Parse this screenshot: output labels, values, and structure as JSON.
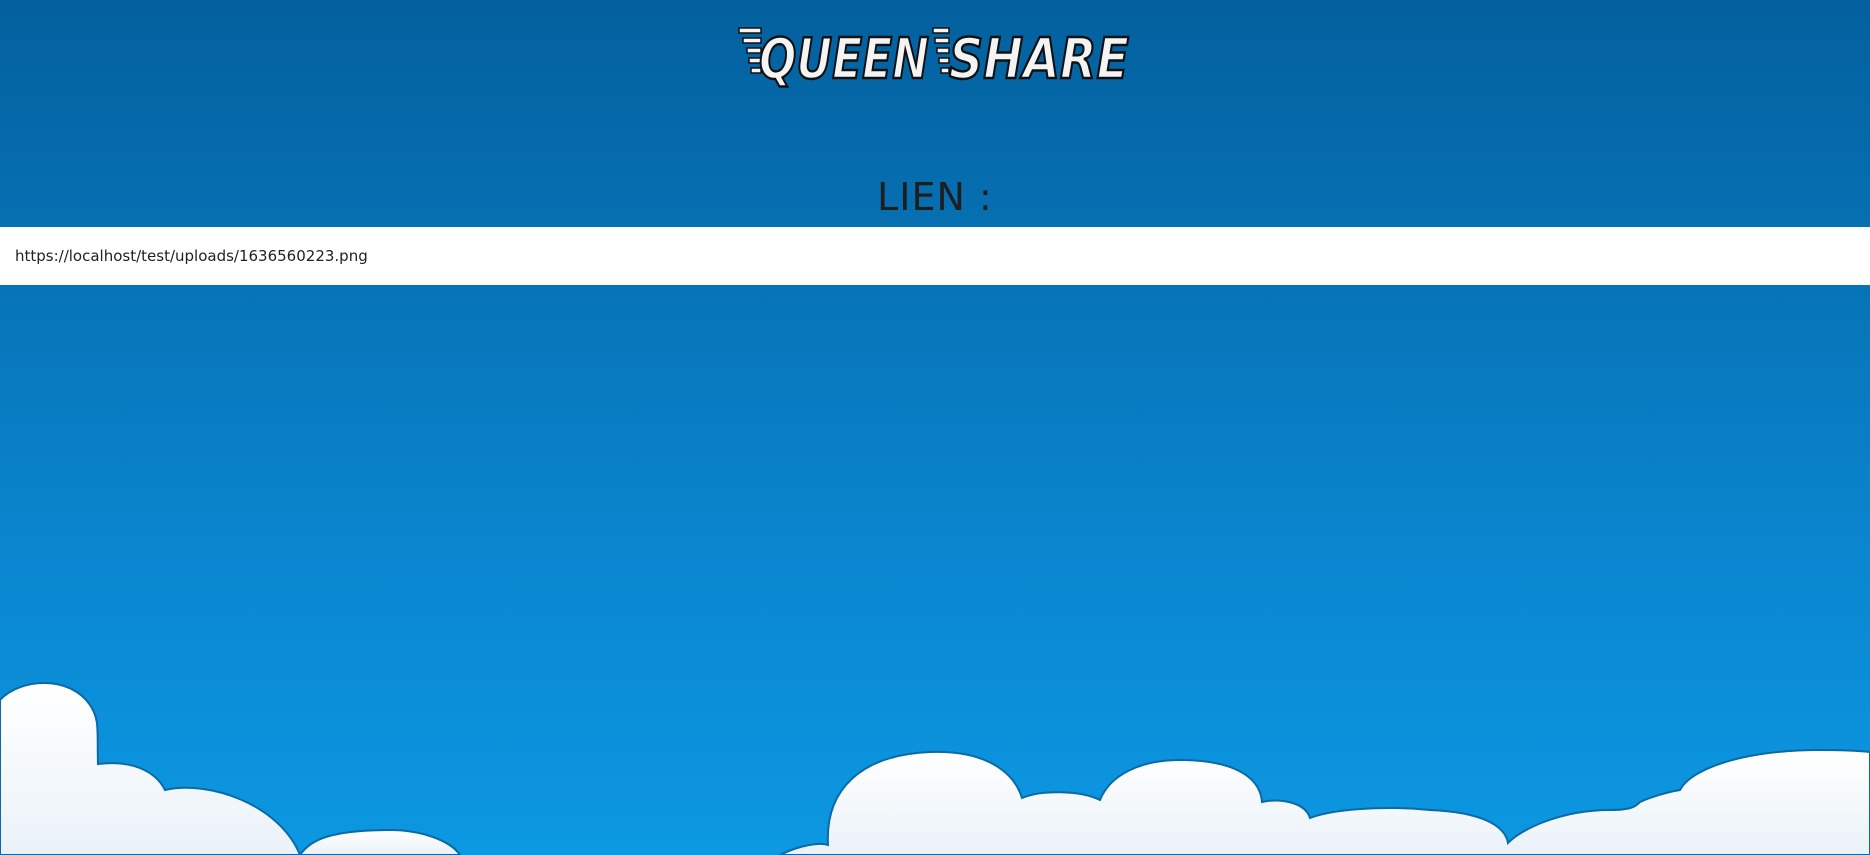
{
  "header": {
    "logo_text_left": "QUEEN",
    "logo_text_right": "SHARE"
  },
  "main": {
    "link_label": "LIEN :",
    "link_value": "https://localhost/test/uploads/1636560223.png"
  },
  "colors": {
    "sky_top": "#04609e",
    "sky_bottom": "#0c98e2",
    "cloud_fill": "#ffffff",
    "cloud_stroke": "#0a6aa8",
    "logo_fill": "#f4f4f4",
    "logo_stroke": "#111111"
  }
}
